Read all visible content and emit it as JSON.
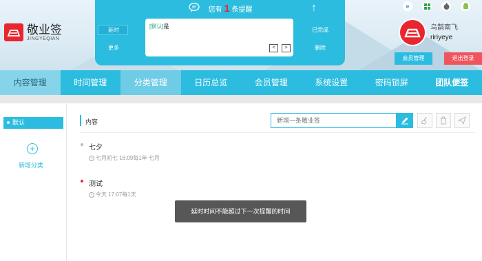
{
  "logo": {
    "cn": "敬业签",
    "en": "JINGYEQIAN"
  },
  "reminder": {
    "prefix": "您有",
    "count": "1",
    "suffix": "条提醒",
    "left_buttons": [
      "延时",
      "更多"
    ],
    "right_buttons": [
      "已完成",
      "删除"
    ],
    "tag": "[默认]",
    "text": "是",
    "prev": "<",
    "next": ">"
  },
  "user": {
    "name_cn": "乌鹊南飞",
    "name_en": "ririyeye",
    "member_button": "会员管理",
    "logout_button": "退出登录"
  },
  "os_icons": [
    "ie-icon",
    "windows-icon",
    "apple-icon",
    "android-icon"
  ],
  "nav": [
    "内容管理",
    "时间管理",
    "分类管理",
    "日历总览",
    "会员管理",
    "系统设置",
    "密码锁屏",
    "团队便签"
  ],
  "sidebar": {
    "default_category": "默认",
    "add_category": "新增分类",
    "add_symbol": "+"
  },
  "main": {
    "title": "内容",
    "search_placeholder": "新增一条敬业签",
    "items": [
      {
        "title": "七夕",
        "meta": "七月初七 16:09每1年 七月",
        "dot_color": "#bbbbbb"
      },
      {
        "title": "测试",
        "meta": "今天 17:07每1天",
        "dot_color": "#e8262f"
      }
    ]
  },
  "toast": "延时时间不能超过下一次提醒的时间",
  "colors": {
    "accent": "#2bbce0",
    "brand_red": "#e8262f",
    "logout_red": "#f0545c"
  }
}
